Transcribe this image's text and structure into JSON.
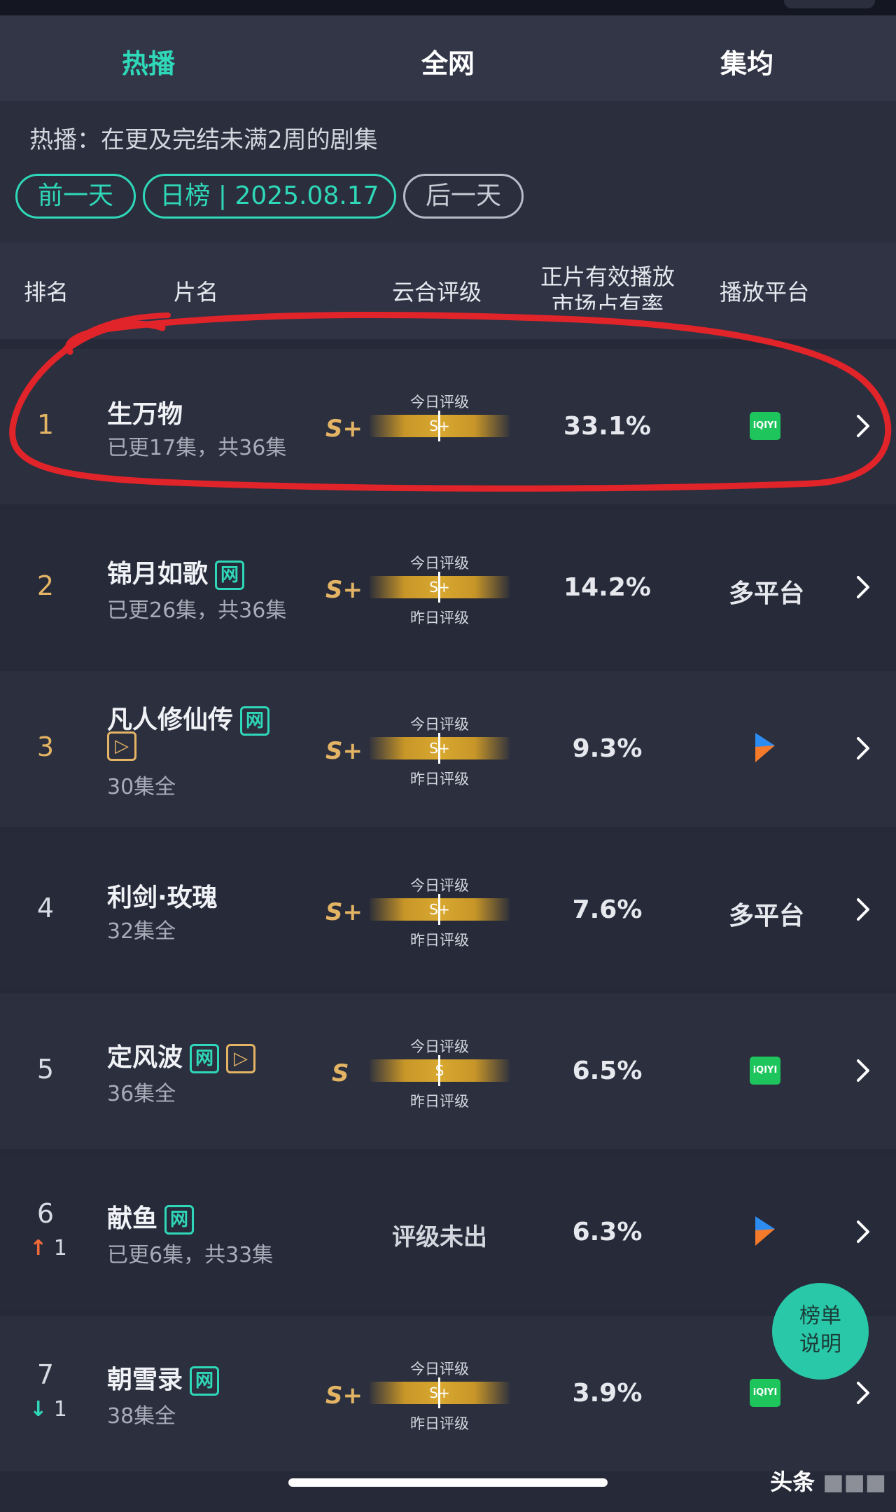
{
  "tabs": [
    "热播",
    "全网",
    "集均"
  ],
  "active_tab": "热播",
  "description": "热播：在更及完结未满2周的剧集",
  "nav": {
    "prev": "前一天",
    "date": "日榜 | 2025.08.17",
    "next": "后一天"
  },
  "columns": {
    "rank": "排名",
    "title": "片名",
    "rating": "云合评级",
    "share_line1": "正片有效播放",
    "share_line2": "市场占有率",
    "platform": "播放平台"
  },
  "labels": {
    "today_rating": "今日评级",
    "yesterday_rating": "昨日评级",
    "no_rating": "评级未出"
  },
  "badges": {
    "web": "网",
    "play": "▷"
  },
  "rows": [
    {
      "rank": "1",
      "change": "",
      "title": "生万物",
      "episodes": "已更17集，共36集",
      "grade": "S+",
      "bar_grade": "S+",
      "share": "33.1%",
      "platform": "iQIYI"
    },
    {
      "rank": "2",
      "change": "",
      "title": "锦月如歌",
      "episodes": "已更26集，共36集",
      "grade": "S+",
      "bar_grade": "S+",
      "share": "14.2%",
      "platform": "多平台"
    },
    {
      "rank": "3",
      "change": "",
      "title": "凡人修仙传",
      "episodes": "30集全",
      "grade": "S+",
      "bar_grade": "S+",
      "share": "9.3%",
      "platform": "Tencent Video"
    },
    {
      "rank": "4",
      "change": "",
      "title": "利剑·玫瑰",
      "episodes": "32集全",
      "grade": "S+",
      "bar_grade": "S+",
      "share": "7.6%",
      "platform": "多平台"
    },
    {
      "rank": "5",
      "change": "",
      "title": "定风波",
      "episodes": "36集全",
      "grade": "S",
      "bar_grade": "S",
      "share": "6.5%",
      "platform": "iQIYI"
    },
    {
      "rank": "6",
      "change": "1",
      "title": "献鱼",
      "episodes": "已更6集，共33集",
      "grade": "",
      "bar_grade": "",
      "share": "6.3%",
      "platform": "Tencent Video"
    },
    {
      "rank": "7",
      "change": "1",
      "title": "朝雪录",
      "episodes": "38集全",
      "grade": "S+",
      "bar_grade": "S+",
      "share": "3.9%",
      "platform": "iQIYI"
    }
  ],
  "fab": {
    "line1": "榜单",
    "line2": "说明"
  },
  "watermark": "头条"
}
